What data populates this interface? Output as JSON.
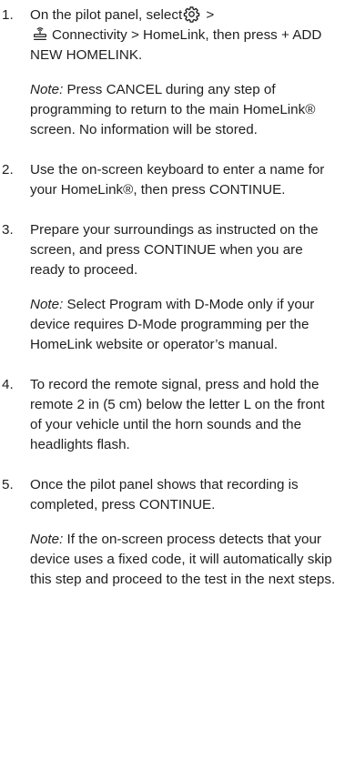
{
  "steps": [
    {
      "number": "1.",
      "text_pre": "On the pilot panel, select",
      "gear_icon": "gear-icon",
      "text_mid": " > ",
      "connectivity_icon": "connectivity-icon",
      "text_post": "Connectivity > HomeLink, then press + ADD NEW HOMELINK.",
      "note_label": "Note:",
      "note_text": " Press CANCEL during any step of programming to return to the main HomeLink® screen. No information will be stored."
    },
    {
      "number": "2.",
      "text": "Use the on-screen keyboard to enter a name for your HomeLink®, then press CONTINUE."
    },
    {
      "number": "3.",
      "text": "Prepare your surroundings as instructed on the screen, and press CONTINUE when you are ready to proceed.",
      "note_label": "Note:",
      "note_text": " Select Program with D-Mode only if your device requires D-Mode programming per the HomeLink website or operator’s manual."
    },
    {
      "number": "4.",
      "text": "To record the remote signal, press and hold the remote 2 in (5 cm) below the letter L on the front of your vehicle until the horn sounds and the headlights flash."
    },
    {
      "number": "5.",
      "text": "Once the pilot panel shows that recording is completed, press CONTINUE.",
      "note_label": "Note:",
      "note_text": " If the on-screen process detects that your device uses a fixed code, it will automatically skip this step and proceed to the test in the next steps."
    }
  ],
  "colors": {
    "text": "#1f1f1f",
    "background": "#ffffff"
  }
}
